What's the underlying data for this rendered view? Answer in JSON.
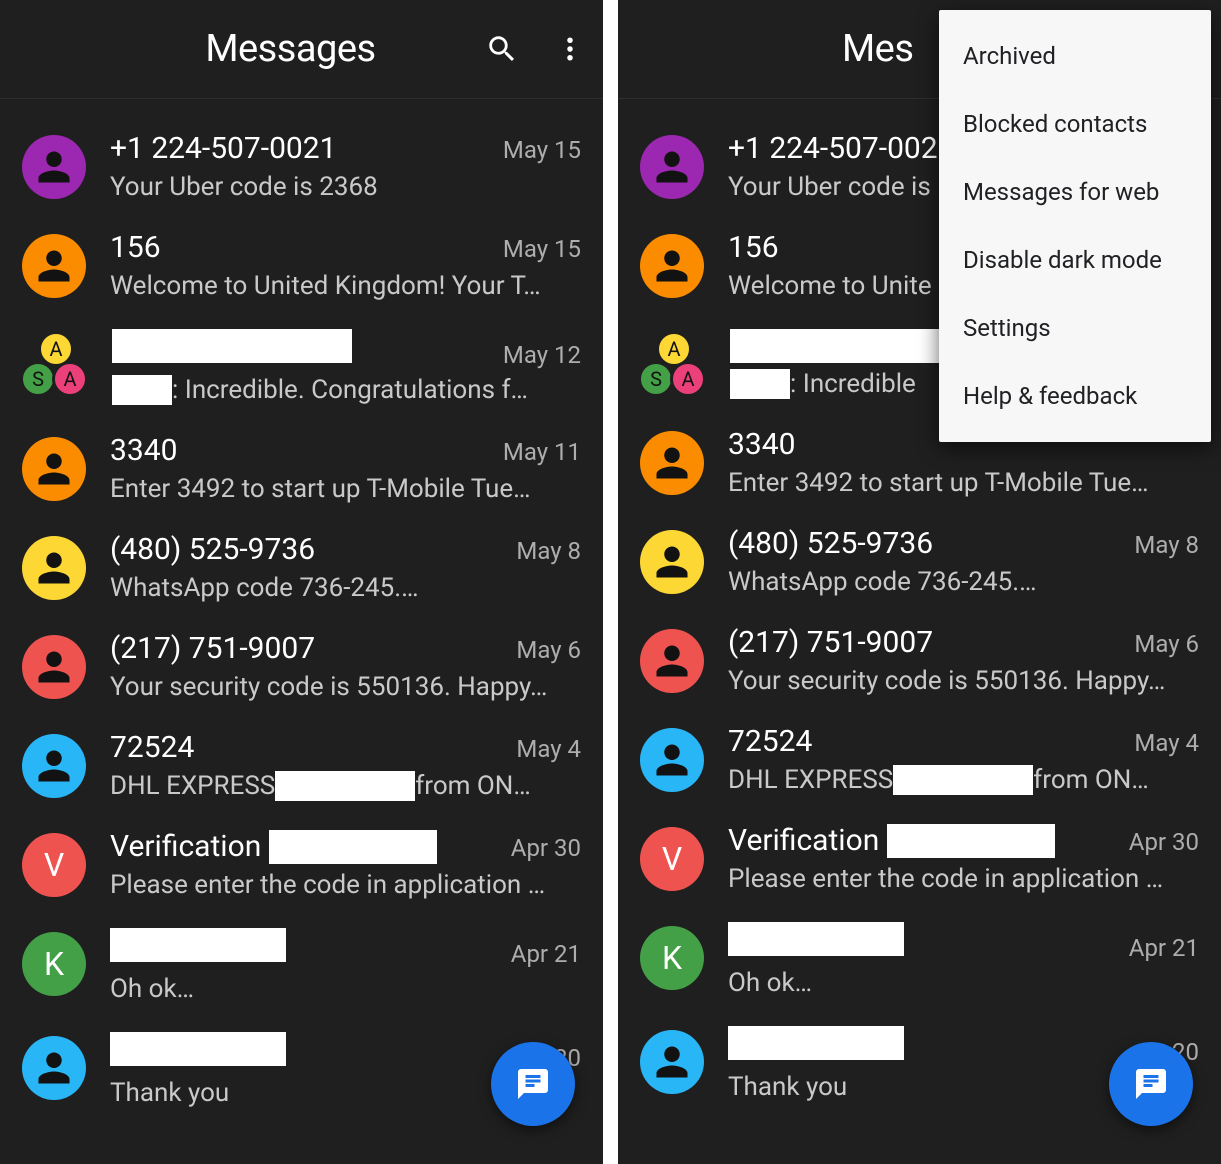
{
  "app": {
    "title": "Messages",
    "title_truncated": "Mes"
  },
  "icons": {
    "search": "search-icon",
    "more": "more-vert-icon",
    "person": "person-icon",
    "fab": "new-message-icon"
  },
  "menu": {
    "items": [
      "Archived",
      "Blocked contacts",
      "Messages for web",
      "Disable dark mode",
      "Settings",
      "Help & feedback"
    ]
  },
  "colors": {
    "purple": "#9c27b0",
    "orange_dark": "#f4511e",
    "orange": "#fb8c00",
    "yellow": "#fdd835",
    "green": "#43a047",
    "pink": "#ec407a",
    "red": "#ef5350",
    "cyan": "#29b6f6",
    "blue": "#1a73e8"
  },
  "threads": [
    {
      "id": "t0",
      "avatar": {
        "type": "person",
        "color": "purple"
      },
      "sender": "+1 224-507-0021",
      "date": "May 15",
      "preview_parts": [
        {
          "text": "Your Uber code is 2368"
        }
      ],
      "right_preview_parts": [
        {
          "text": "Your Uber code is"
        }
      ]
    },
    {
      "id": "t1",
      "avatar": {
        "type": "person",
        "color": "orange"
      },
      "sender": "156",
      "date": "May 15",
      "preview_parts": [
        {
          "text": "Welcome to United Kingdom! Your T…"
        }
      ],
      "right_preview_parts": [
        {
          "text": "Welcome to Unite"
        }
      ]
    },
    {
      "id": "t2",
      "avatar": {
        "type": "group",
        "members": [
          {
            "letter": "A",
            "color": "yellow"
          },
          {
            "letter": "S",
            "color": "green"
          },
          {
            "letter": "A",
            "color": "pink"
          }
        ]
      },
      "sender": "",
      "sender_redacted": true,
      "date": "May 12",
      "preview_parts": [
        {
          "redact_w": 60
        },
        {
          "text": ": Incredible. Congratulations f…"
        }
      ],
      "right_preview_parts": [
        {
          "redact_w": 60
        },
        {
          "text": ": Incredible"
        }
      ]
    },
    {
      "id": "t3",
      "avatar": {
        "type": "person",
        "color": "orange"
      },
      "sender": "3340",
      "date": "May 11",
      "preview_parts": [
        {
          "text": "Enter 3492 to start up T-Mobile Tue…"
        }
      ]
    },
    {
      "id": "t4",
      "avatar": {
        "type": "person",
        "color": "yellow"
      },
      "sender": "(480) 525-9736",
      "date": "May 8",
      "preview_parts": [
        {
          "text": "WhatsApp code 736-245.…"
        }
      ]
    },
    {
      "id": "t5",
      "avatar": {
        "type": "person",
        "color": "red"
      },
      "sender": "(217) 751-9007",
      "date": "May 6",
      "preview_parts": [
        {
          "text": "Your security code is 550136. Happy…"
        }
      ]
    },
    {
      "id": "t6",
      "avatar": {
        "type": "person",
        "color": "cyan"
      },
      "sender": "72524",
      "date": "May 4",
      "preview_parts": [
        {
          "text": "DHL EXPRESS "
        },
        {
          "redact_w": 140
        },
        {
          "text": " from ON…"
        }
      ]
    },
    {
      "id": "t7",
      "avatar": {
        "type": "letter",
        "letter": "V",
        "color": "red",
        "text_white": true
      },
      "sender": "Verification",
      "sender_redact_after": 168,
      "date": "Apr 30",
      "preview_parts": [
        {
          "text": "Please enter the code in application …"
        }
      ]
    },
    {
      "id": "t8",
      "avatar": {
        "type": "letter",
        "letter": "K",
        "color": "green",
        "text_white": true
      },
      "sender": "",
      "sender_redacted": true,
      "sender_redact_w": 176,
      "date": "Apr 21",
      "preview_parts": [
        {
          "text": "Oh ok…"
        }
      ]
    },
    {
      "id": "t9",
      "avatar": {
        "type": "person",
        "color": "cyan"
      },
      "sender": "",
      "sender_redacted": true,
      "sender_redact_w": 176,
      "date": "20",
      "date_right_only_format": true,
      "preview_parts": [
        {
          "text": "Thank you"
        }
      ]
    }
  ]
}
